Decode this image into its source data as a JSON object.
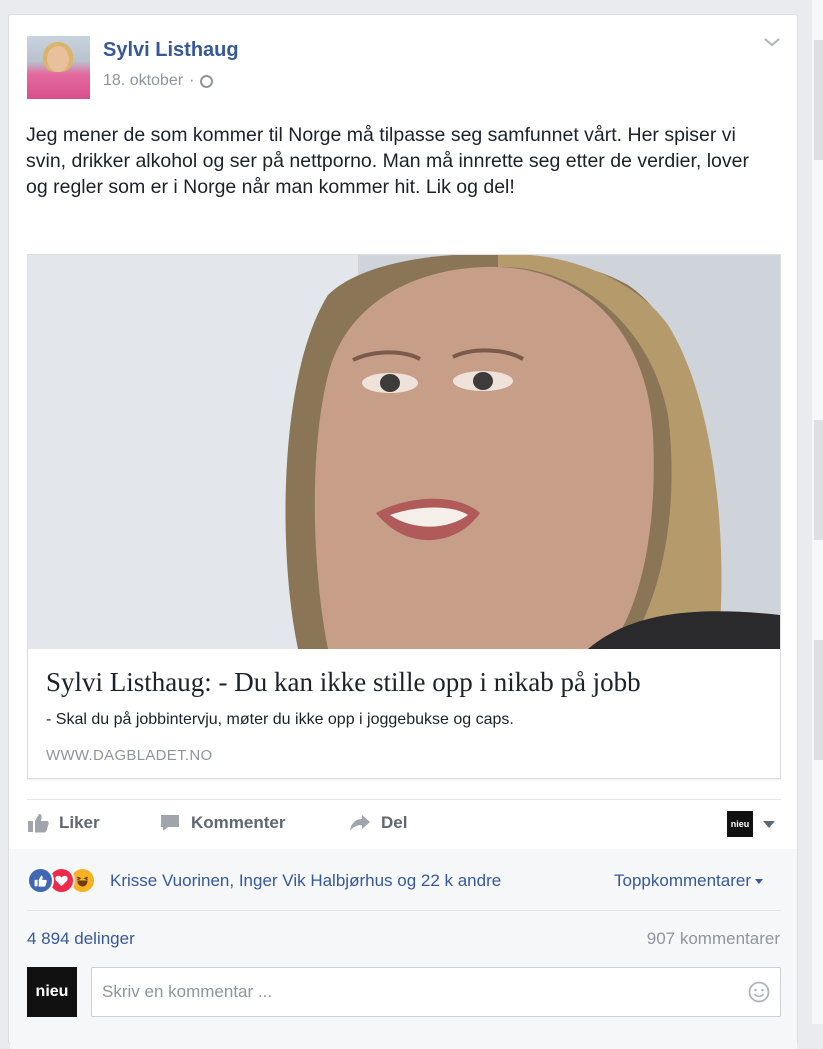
{
  "post": {
    "author": "Sylvi Listhaug",
    "date": "18. oktober",
    "separator": "·",
    "audience_icon": "globe-icon",
    "text": "Jeg mener de som kommer til Norge må tilpasse seg samfunnet vårt. Her spiser vi svin, drikker alkohol og ser på nettporno. Man må innrette seg etter de verdier, lover og regler som er i Norge når man kommer hit. Lik og del!"
  },
  "link": {
    "title": "Sylvi Listhaug: - Du kan ikke stille opp i nikab på jobb",
    "description": "- Skal du på jobbintervju, møter du ikke opp i joggebukse og caps.",
    "domain": "WWW.DAGBLADET.NO"
  },
  "actions": {
    "like": "Liker",
    "comment": "Kommenter",
    "share": "Del"
  },
  "page_selector": {
    "logo_text": "nieu"
  },
  "social": {
    "reaction_icons": [
      "like-reaction-icon",
      "love-reaction-icon",
      "haha-reaction-icon"
    ],
    "reactors": "Krisse Vuorinen, Inger Vik Halbjørhus og 22 k andre",
    "top_comments": "Toppkommentarer",
    "shares": "4 894 delinger",
    "comments": "907 kommentarer"
  },
  "composer": {
    "avatar_text": "nieu",
    "placeholder": "Skriv en kommentar ..."
  },
  "colors": {
    "link_blue": "#365899",
    "text": "#1d2129",
    "muted": "#90949c",
    "like_blue": "#4267b2",
    "love_red": "#f0284a",
    "haha_yellow": "#f7b125"
  }
}
